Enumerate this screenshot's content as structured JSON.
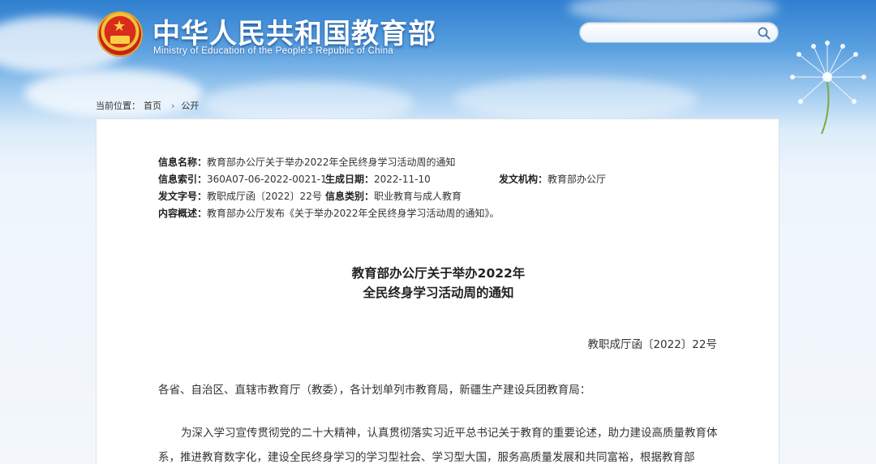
{
  "header": {
    "site_title_cn": "中华人民共和国教育部",
    "site_title_en": "Ministry of Education of the People's Republic of China",
    "emblem_icon": "national-emblem-icon",
    "search": {
      "placeholder": "",
      "icon": "search-icon"
    }
  },
  "breadcrumb": {
    "prefix": "当前位置：",
    "items": [
      "首页",
      "公开"
    ]
  },
  "info": {
    "name_label": "信息名称：",
    "name_value": "教育部办公厅关于举办2022年全民终身学习活动周的通知",
    "index_label": "信息索引：",
    "index_value": "360A07-06-2022-0021-1",
    "date_label": "生成日期：",
    "date_value": "2022-11-10",
    "issuer_label": "发文机构：",
    "issuer_value": "教育部办公厅",
    "docno_label": "发文字号：",
    "docno_value": "教职成厅函〔2022〕22号",
    "category_label": "信息类别：",
    "category_value": "职业教育与成人教育",
    "summary_label": "内容概述：",
    "summary_value": "教育部办公厅发布《关于举办2022年全民终身学习活动周的通知》。"
  },
  "document": {
    "title_line1": "教育部办公厅关于举办2022年",
    "title_line2": "全民终身学习活动周的通知",
    "doc_number": "教职成厅函〔2022〕22号",
    "addressee": "各省、自治区、直辖市教育厅（教委），各计划单列市教育局，新疆生产建设兵团教育局：",
    "paragraph1": "为深入学习宣传贯彻党的二十大精神，认真贯彻落实习近平总书记关于教育的重要论述，助力建设高质量教育体系，推进教育数字化，建设全民终身学习的学习型社会、学习型大国，服务高质量发展和共同富裕，根据教育部"
  },
  "colors": {
    "sky_top": "#2f7fd0",
    "sky_bottom": "#eef5fc",
    "emblem_red": "#d92b1c",
    "emblem_gold": "#f0c23a"
  }
}
